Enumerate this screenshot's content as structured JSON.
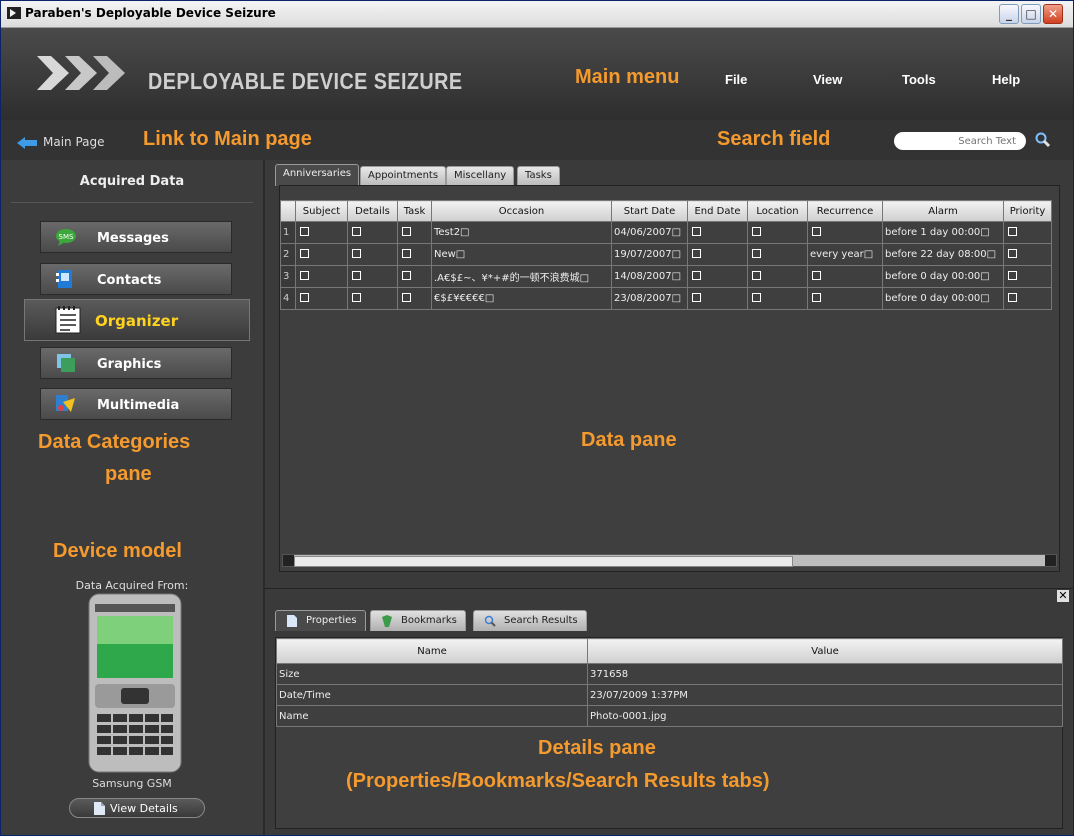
{
  "window": {
    "title": "Paraben's Deployable Device Seizure"
  },
  "header": {
    "app_name": "DEPLOYABLE DEVICE SEIZURE",
    "menu": [
      "File",
      "View",
      "Tools",
      "Help"
    ]
  },
  "nav": {
    "main_page_label": "Main Page",
    "search_placeholder": "Search Text"
  },
  "annotations": {
    "main_menu": "Main menu",
    "link_main": "Link to Main page",
    "search_field": "Search field",
    "data_categories_1": "Data Categories",
    "data_categories_2": "pane",
    "device_model": "Device model",
    "data_pane": "Data pane",
    "details_1": "Details pane",
    "details_2": "(Properties/Bookmarks/Search Results tabs)"
  },
  "sidebar": {
    "title": "Acquired Data",
    "categories": [
      {
        "label": "Messages",
        "icon": "sms-icon"
      },
      {
        "label": "Contacts",
        "icon": "contacts-icon"
      },
      {
        "label": "Organizer",
        "icon": "organizer-icon"
      },
      {
        "label": "Graphics",
        "icon": "graphics-icon"
      },
      {
        "label": "Multimedia",
        "icon": "multimedia-icon"
      }
    ],
    "active_category": "Organizer",
    "acquired_from_label": "Data Acquired From:",
    "device_name": "Samsung GSM",
    "view_details_label": "View Details"
  },
  "data_pane": {
    "tabs": [
      "Anniversaries",
      "Appointments",
      "Miscellany",
      "Tasks"
    ],
    "active_tab": "Anniversaries",
    "columns": [
      "Subject",
      "Details",
      "Task",
      "Occasion",
      "Start Date",
      "End Date",
      "Location",
      "Recurrence",
      "Alarm",
      "Priority"
    ],
    "rows": [
      {
        "num": "1",
        "occasion": "Test2□",
        "start": "04/06/2007□",
        "recurrence": "",
        "alarm": "before 1 day 00:00□"
      },
      {
        "num": "2",
        "occasion": "New□",
        "start": "19/07/2007□",
        "recurrence": "every year□",
        "alarm": "before 22 day 08:00□"
      },
      {
        "num": "3",
        "occasion": ".A€$£~、¥*+#的一顿不浪费城□",
        "start": "14/08/2007□",
        "recurrence": "",
        "alarm": "before 0 day 00:00□"
      },
      {
        "num": "4",
        "occasion": "€$£¥€€€€□",
        "start": "23/08/2007□",
        "recurrence": "",
        "alarm": "before 0 day 00:00□"
      }
    ]
  },
  "details_pane": {
    "tabs": [
      "Properties",
      "Bookmarks",
      "Search Results"
    ],
    "active_tab": "Properties",
    "columns": [
      "Name",
      "Value"
    ],
    "rows": [
      {
        "name": "Size",
        "value": "371658"
      },
      {
        "name": "Date/Time",
        "value": "23/07/2009 1:37PM"
      },
      {
        "name": "Name",
        "value": "Photo-0001.jpg"
      }
    ]
  },
  "colors": {
    "annotation": "#f49a2e",
    "active_category": "#ffd21f"
  }
}
